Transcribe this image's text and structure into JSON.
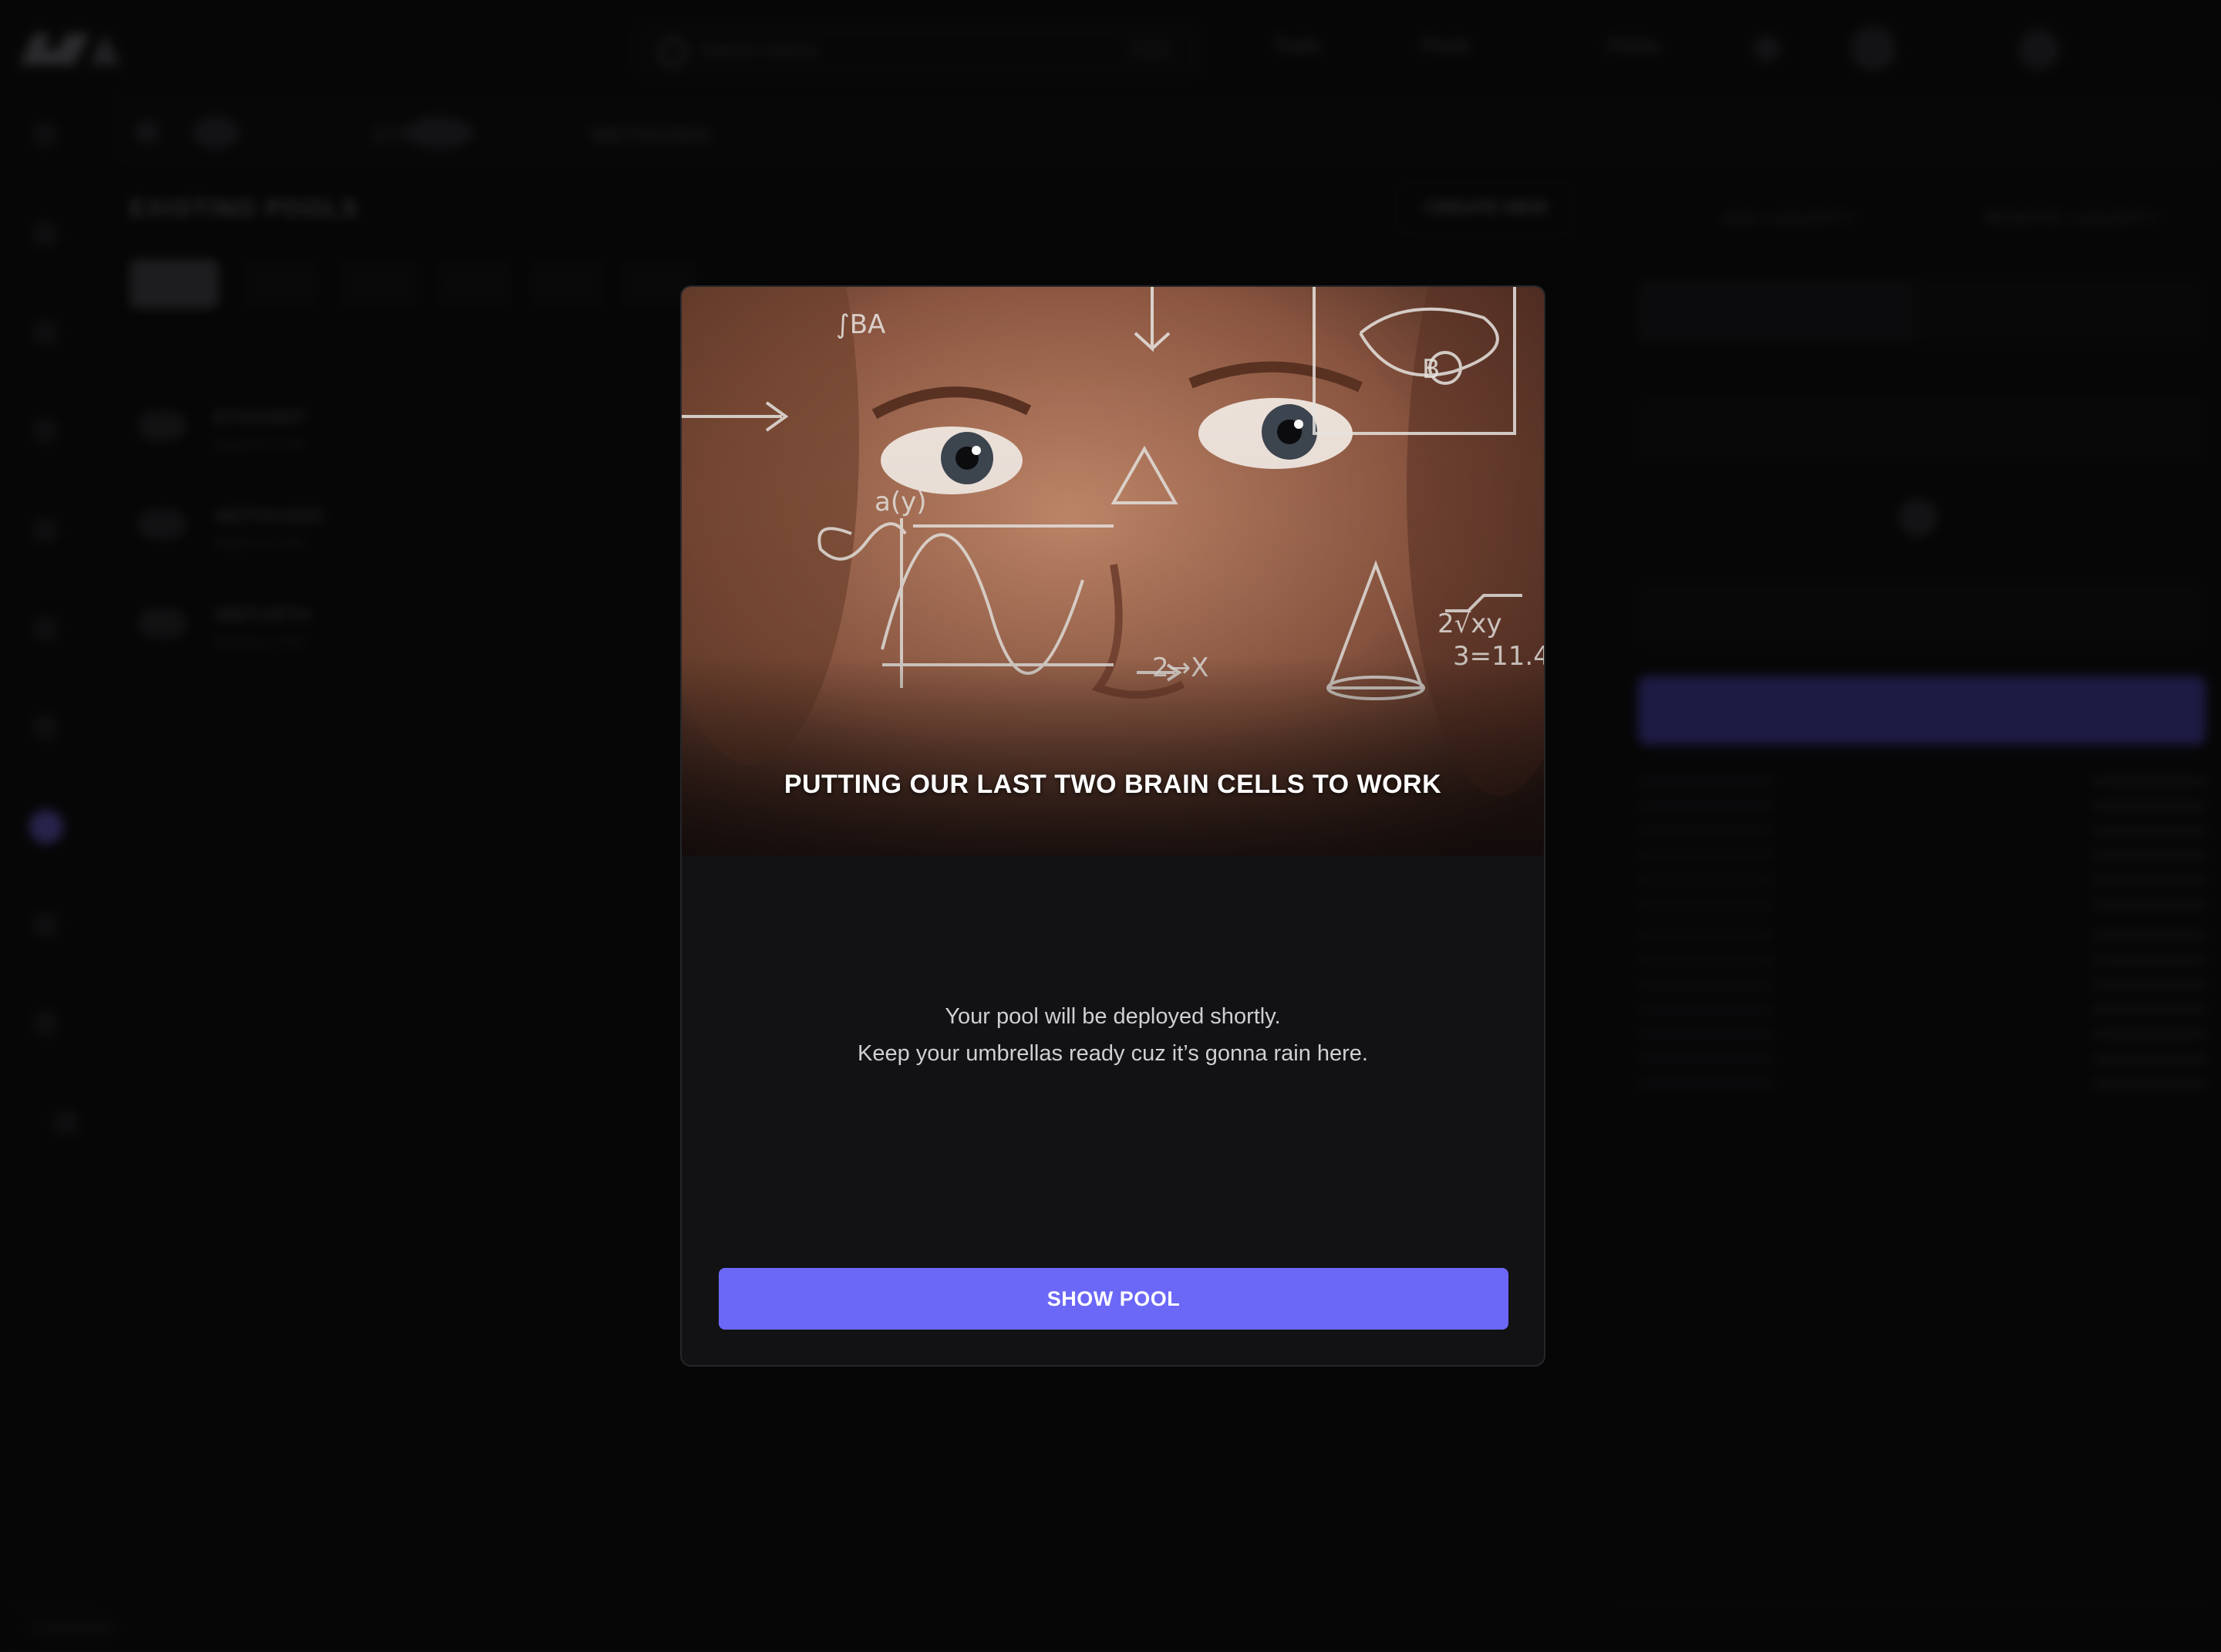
{
  "app": {
    "nav": {
      "search_placeholder": "Search tokens",
      "link1": "Trade",
      "link2": "Pools",
      "link3": "Points"
    },
    "breadcrumb": {
      "pair1": "ETH/USDT",
      "pair2": "WETH/USDC"
    },
    "pools": {
      "title": "EXISTING POOLS",
      "create_label": "CREATE NEW",
      "rows": [
        {
          "name": "ETH/USDT",
          "sub": "Balance 0.00"
        },
        {
          "name": "WETH/USDC",
          "sub": "Balance 0.00"
        },
        {
          "name": "WBTC/ETH",
          "sub": "Balance 0.00"
        }
      ]
    },
    "panel": {
      "tab1": "ADD LIQUIDITY",
      "tab2": "REMOVE LIQUIDITY",
      "seg1": "SINGLE",
      "seg2": "DUAL"
    },
    "footer": {
      "status": "Connected"
    }
  },
  "modal": {
    "caption": "PUTTING OUR LAST TWO BRAIN CELLS TO  WORK",
    "message_line1": "Your pool will be deployed shortly.",
    "message_line2": "Keep your umbrellas ready cuz it’s gonna rain here.",
    "button_label": "SHOW POOL"
  },
  "colors": {
    "accent": "#6b67f7",
    "background": "#0b0b0c",
    "modal_bg": "#121214"
  }
}
